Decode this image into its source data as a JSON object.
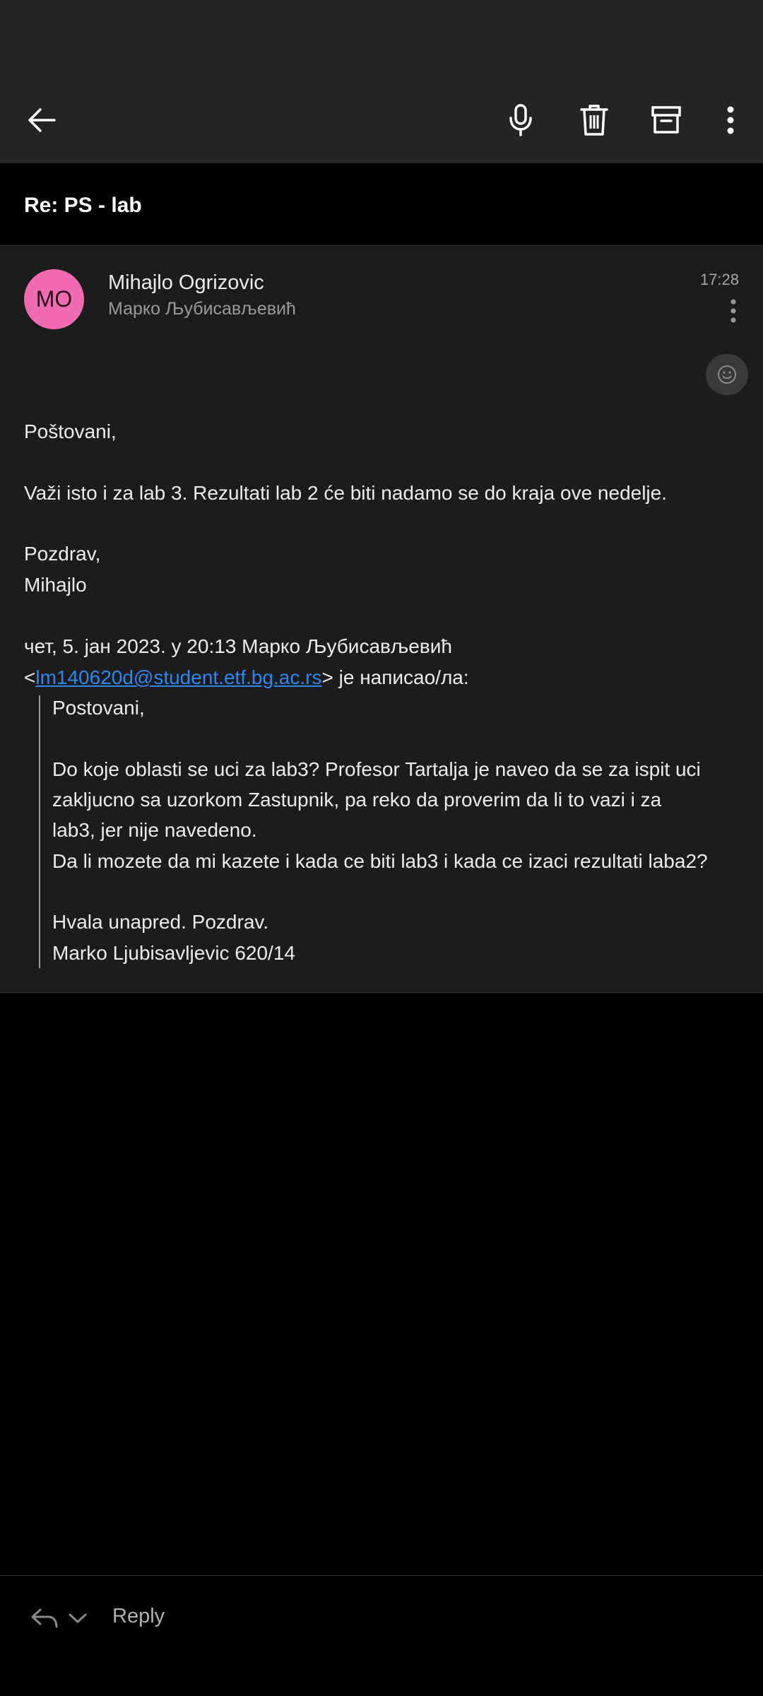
{
  "toolbar": {
    "back_icon": "arrow-left-icon",
    "mic_icon": "microphone-icon",
    "delete_icon": "trash-icon",
    "archive_icon": "archive-icon",
    "more_icon": "more-vertical-icon"
  },
  "email": {
    "subject": "Re: PS - lab",
    "avatar_initials": "MO",
    "avatar_color": "#f06bb1",
    "sender_name": "Mihajlo Ogrizovic",
    "recipient": "Марко Љубисављевић",
    "time": "17:28",
    "body": {
      "greeting": "Poštovani,",
      "line1": "Važi isto i za lab 3. Rezultati lab 2 će biti nadamo se do kraja ove nedelje.",
      "closing": "Pozdrav,",
      "signature": "Mihajlo"
    },
    "quote_header": {
      "line1": "чет, 5. јан 2023. у 20:13 Марко Љубисављевић",
      "open_bracket": "<",
      "email_address": "lm140620d@student.etf.bg.ac.rs",
      "suffix": "> је написао/ла:"
    },
    "quoted": {
      "greeting": "Postovani,",
      "line1": "Do koje oblasti se uci za lab3? Profesor Tartalja je naveo da se za ispit uci",
      "line2": "zakljucno sa uzorkom Zastupnik, pa reko da proverim da li to vazi i za",
      "line3": "lab3, jer nije navedeno.",
      "line4": "Da li mozete da mi kazete i kada ce biti lab3 i kada ce izaci rezultati laba2?",
      "thanks": "Hvala unapred. Pozdrav.",
      "signature": "Marko Ljubisavljevic 620/14"
    }
  },
  "bottom_bar": {
    "reply_label": "Reply"
  },
  "colors": {
    "link": "#2e86f0",
    "toolbar_bg": "#242424",
    "message_bg": "#1c1c1c"
  }
}
